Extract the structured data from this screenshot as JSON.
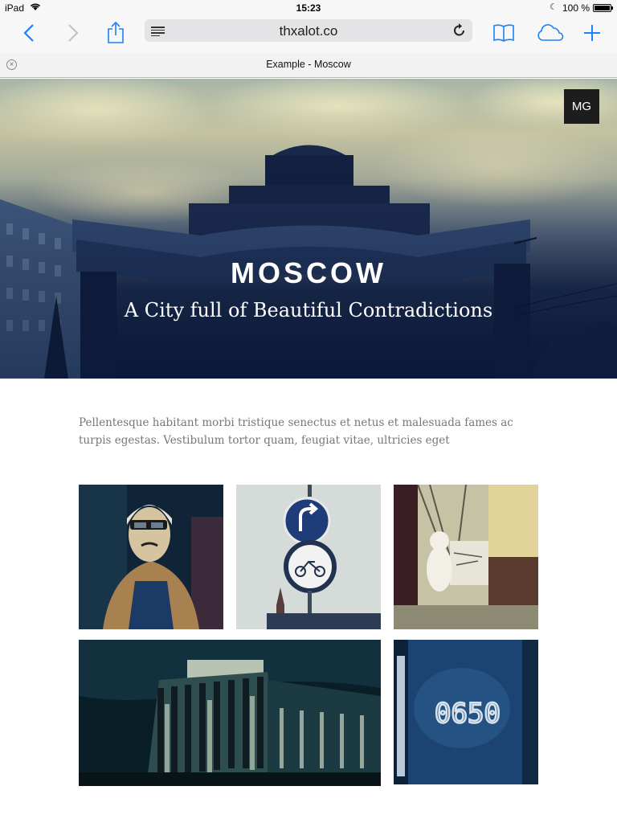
{
  "status_bar": {
    "carrier": "iPad",
    "time": "15:23",
    "battery": "100 %"
  },
  "toolbar": {
    "url": "thxalot.co",
    "icons": [
      "back-icon",
      "forward-icon",
      "share-icon",
      "reader-icon",
      "reload-icon",
      "bookmarks-icon",
      "icloud-tabs-icon",
      "new-tab-icon"
    ]
  },
  "tab": {
    "title": "Example - Moscow"
  },
  "hero": {
    "badge": "MG",
    "title": "MOSCOW",
    "subtitle": "A City full of Beautiful Contradictions"
  },
  "intro": {
    "text": "Pellentesque habitant morbi tristique senectus et netus et malesuada fames ac turpis egestas. Vestibulum tortor quam, feugiat vitae, ultricies eget"
  },
  "gallery": {
    "door_number": "0650"
  },
  "colors": {
    "ios_blue": "#1a82fb",
    "hero_dark": "#0f2044",
    "text_gray": "#777777",
    "badge_bg": "#1d1d1d"
  }
}
